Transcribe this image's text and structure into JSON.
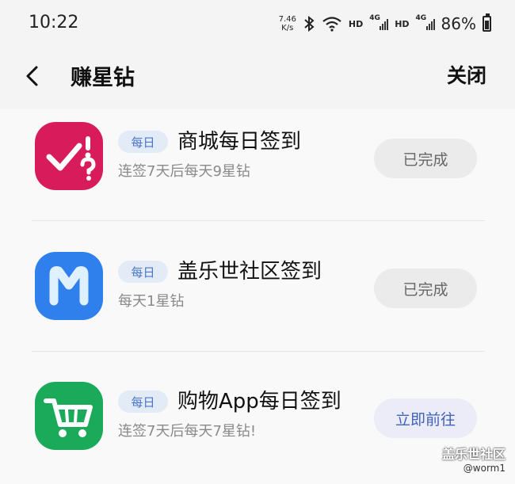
{
  "status_bar": {
    "time": "10:22",
    "net_speed_value": "7.46",
    "net_speed_unit": "K/s",
    "hd_label": "HD",
    "network_label": "4G",
    "battery": "86%"
  },
  "header": {
    "title": "赚星钻",
    "close_label": "关闭"
  },
  "tasks": [
    {
      "badge": "每日",
      "title": "商城每日签到",
      "desc": "连签7天后每天9星钻",
      "button": "已完成",
      "icon": "check-question-icon",
      "color": "#d81b5a"
    },
    {
      "badge": "每日",
      "title": "盖乐世社区签到",
      "desc": "每天1星钻",
      "button": "已完成",
      "icon": "m-logo-icon",
      "color": "#2f80ed"
    },
    {
      "badge": "每日",
      "title": "购物App每日签到",
      "desc": "连签7天后每天7星钻!",
      "button": "立即前往",
      "icon": "shopping-cart-icon",
      "color": "#1aaa5a"
    }
  ],
  "watermark": {
    "brand": "盖乐世社区",
    "user": "@worm1"
  }
}
